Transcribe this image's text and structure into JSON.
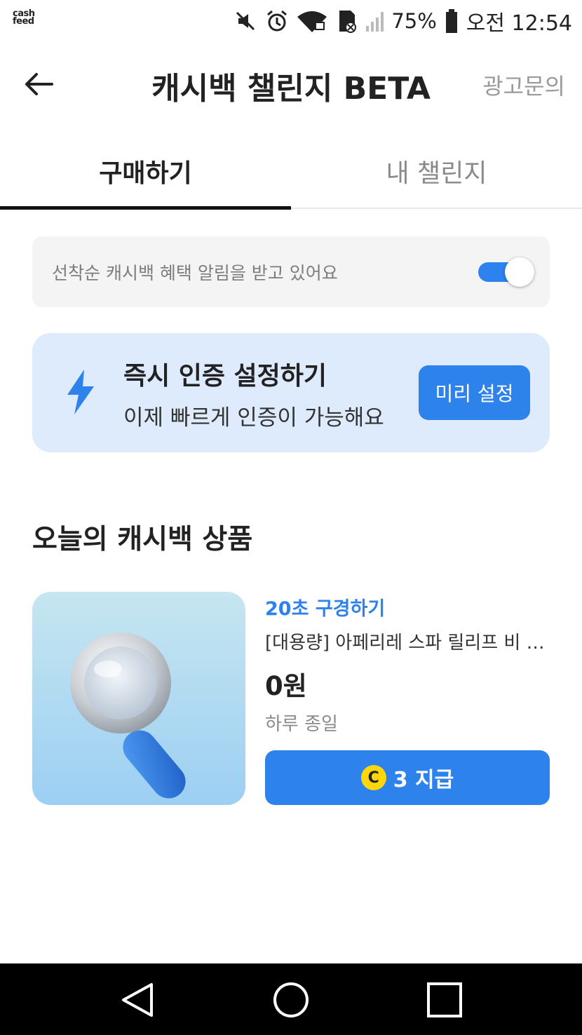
{
  "status_bar": {
    "logo_top": "cash",
    "logo_bottom": "feed",
    "battery_percent": "75%",
    "time": "오전 12:54",
    "icons": [
      "mute-icon",
      "alarm-icon",
      "wifi-lock-icon",
      "sd-card-icon",
      "signal-icon",
      "battery-icon"
    ]
  },
  "header": {
    "title": "캐시백 챌린지 BETA",
    "ad_link": "광고문의",
    "back_icon": "arrow-left-icon"
  },
  "tabs": [
    {
      "label": "구매하기",
      "active": true
    },
    {
      "label": "내 챌린지",
      "active": false
    }
  ],
  "notice": {
    "text": "선착순 캐시백 혜택 알림을 받고 있어요",
    "toggle_on": true
  },
  "instant_verify": {
    "icon": "lightning-bolt-icon",
    "title": "즉시 인증 설정하기",
    "subtitle": "이제 빠르게 인증이 가능해요",
    "button_label": "미리 설정"
  },
  "section": {
    "title": "오늘의 캐시백 상품"
  },
  "product": {
    "image_icon": "magnifier-icon",
    "tag": "20초 구경하기",
    "name": "[대용량] 아페리레 스파 릴리프 비 …",
    "price": "0원",
    "period": "하루 종일",
    "reward_coin": "C",
    "reward_label": "3 지급"
  },
  "colors": {
    "accent": "#2d82ec",
    "verify_bg": "#deebfc",
    "notice_bg": "#f4f4f5",
    "coin": "#ffd60a"
  },
  "nav_bar": {
    "icons": [
      "back-triangle-icon",
      "home-circle-icon",
      "recents-square-icon"
    ]
  }
}
